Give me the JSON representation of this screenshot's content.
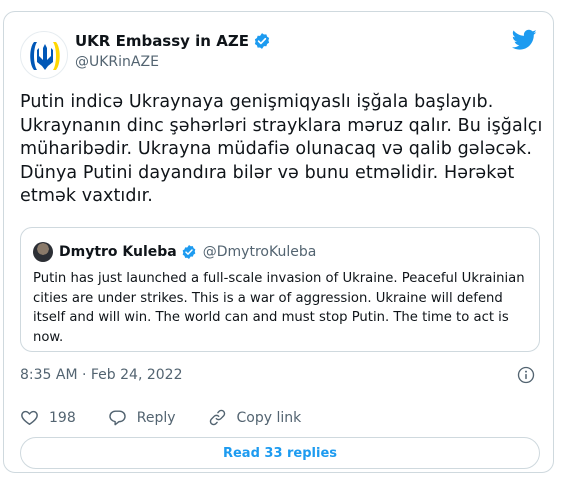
{
  "author": {
    "name": "UKR Embassy in AZE",
    "handle": "@UKRinAZE"
  },
  "tweet": {
    "lines": [
      "Putin indicə Ukraynaya genişmiqyaslı işğala başlayıb.",
      "Ukraynanın dinc şəhərləri strayklara məruz qalır.  Bu işğalçı",
      "müharibədir. Ukrayna müdafiə olunacaq və qalib gələcək.",
      "Dünya Putini dayandıra bilər və bunu etməlidir. Hərəkət",
      "etmək vaxtıdır."
    ]
  },
  "quote": {
    "name": "Dmytro Kuleba",
    "handle": "@DmytroKuleba",
    "lines": [
      "Putin has just launched a full-scale invasion of Ukraine. Peaceful Ukrainian",
      "cities are under strikes. This is a war of aggression. Ukraine will defend",
      "itself and will win. The world can and must stop Putin. The time to act is",
      "now."
    ]
  },
  "timestamp": "8:35 AM · Feb 24, 2022",
  "actions": {
    "like_count": "198",
    "reply_label": "Reply",
    "copy_label": "Copy link"
  },
  "read_replies": "Read 33 replies",
  "colors": {
    "accent": "#1d9bf0",
    "ukraine_blue": "#0057b7",
    "ukraine_yellow": "#ffd700",
    "secondary_text": "#536471",
    "border": "#cfd9de"
  },
  "icons": [
    "ukraine-trident-logo-icon",
    "verified-badge-icon",
    "twitter-bird-icon",
    "info-icon",
    "heart-icon",
    "reply-bubble-icon",
    "link-icon"
  ]
}
